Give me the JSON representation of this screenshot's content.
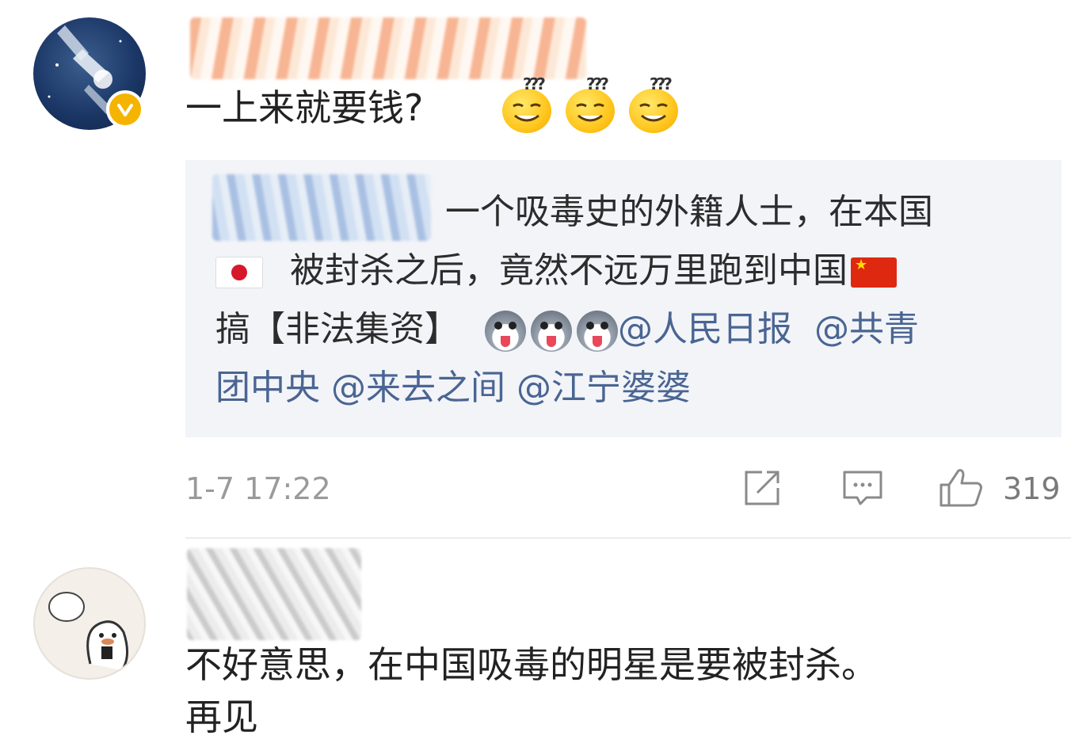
{
  "comment_1": {
    "text": "一上来就要钱?",
    "emoji_count": 3,
    "emoji_icon": "confused-smile-emoji",
    "verified_badge_color": "#f5b400",
    "quoted": {
      "line_1": "一个吸毒史的外籍人士，在本国",
      "line_2": "被封杀之后，竟然不远万里跑到中国",
      "line_3_prefix": "搞【非法集资】",
      "line_3_mention_1": "@人民日报",
      "line_3_mention_2": "@共青",
      "line_4_mention_1": "团中央",
      "line_4_mention_2": "@来去之间",
      "line_4_mention_3": "@江宁婆婆",
      "flag_1": "japan-flag-emoji",
      "flag_2": "china-flag-emoji",
      "dog_emoji_count": 3
    },
    "timestamp": "1-7 17:22",
    "actions": {
      "share_icon": "share-icon",
      "comment_icon": "comment-icon",
      "like_icon": "thumbs-up-icon",
      "like_count": "319"
    }
  },
  "comment_2": {
    "text_line_1": "不好意思，在中国吸毒的明星是要被封杀。",
    "text_line_2": "再见"
  },
  "colors": {
    "mention": "#4a6592",
    "quote_background": "#f2f4f8",
    "meta_text": "#9a9a9a"
  }
}
